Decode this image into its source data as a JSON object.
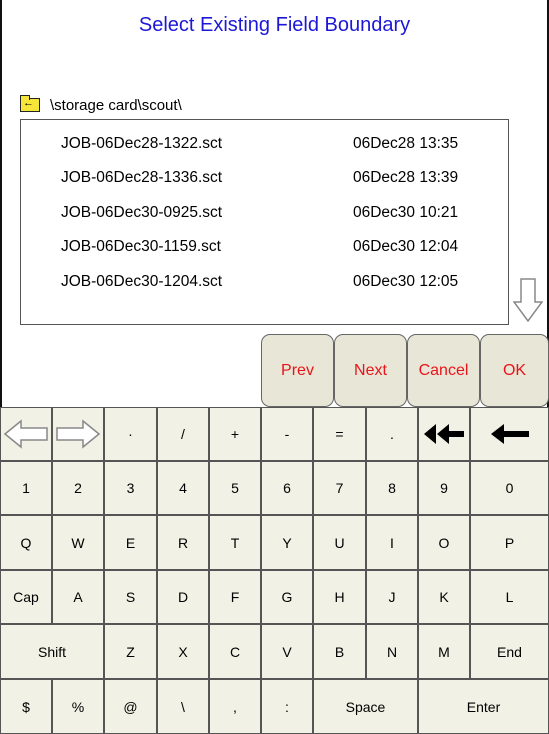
{
  "title": "Select Existing Field Boundary",
  "path": {
    "icon": "folder-up-icon",
    "label": "\\storage card\\scout\\"
  },
  "files": [
    {
      "name": "JOB-06Dec28-1322.sct",
      "date": "06Dec28 13:35"
    },
    {
      "name": "JOB-06Dec28-1336.sct",
      "date": "06Dec28 13:39"
    },
    {
      "name": "JOB-06Dec30-0925.sct",
      "date": "06Dec30 10:21"
    },
    {
      "name": "JOB-06Dec30-1159.sct",
      "date": "06Dec30 12:04"
    },
    {
      "name": "JOB-06Dec30-1204.sct",
      "date": "06Dec30 12:05"
    }
  ],
  "actions": {
    "prev": "Prev",
    "next": "Next",
    "cancel": "Cancel",
    "ok": "OK"
  },
  "keyboard": {
    "row1": [
      "·",
      "/",
      "+",
      "-",
      "=",
      "."
    ],
    "row2": [
      "1",
      "2",
      "3",
      "4",
      "5",
      "6",
      "7",
      "8",
      "9",
      "0"
    ],
    "row3": [
      "Q",
      "W",
      "E",
      "R",
      "T",
      "Y",
      "U",
      "I",
      "O",
      "P"
    ],
    "row4": [
      "Cap",
      "A",
      "S",
      "D",
      "F",
      "G",
      "H",
      "J",
      "K",
      "L"
    ],
    "row5": [
      "Shift",
      "Z",
      "X",
      "C",
      "V",
      "B",
      "N",
      "M",
      "End"
    ],
    "row6": [
      "$",
      "%",
      "@",
      "\\",
      ",",
      ":",
      "Space",
      "Enter"
    ],
    "icons": {
      "arrow_left": "arrow-left-outline-icon",
      "arrow_right": "arrow-right-outline-icon",
      "delete_word": "double-arrow-left-icon",
      "backspace": "arrow-left-bold-icon"
    }
  },
  "colors": {
    "title": "#1d18d8",
    "action_text": "#e8141a",
    "button_bg": "#e8e6d6",
    "keyboard_bg": "#f1f1e5"
  }
}
